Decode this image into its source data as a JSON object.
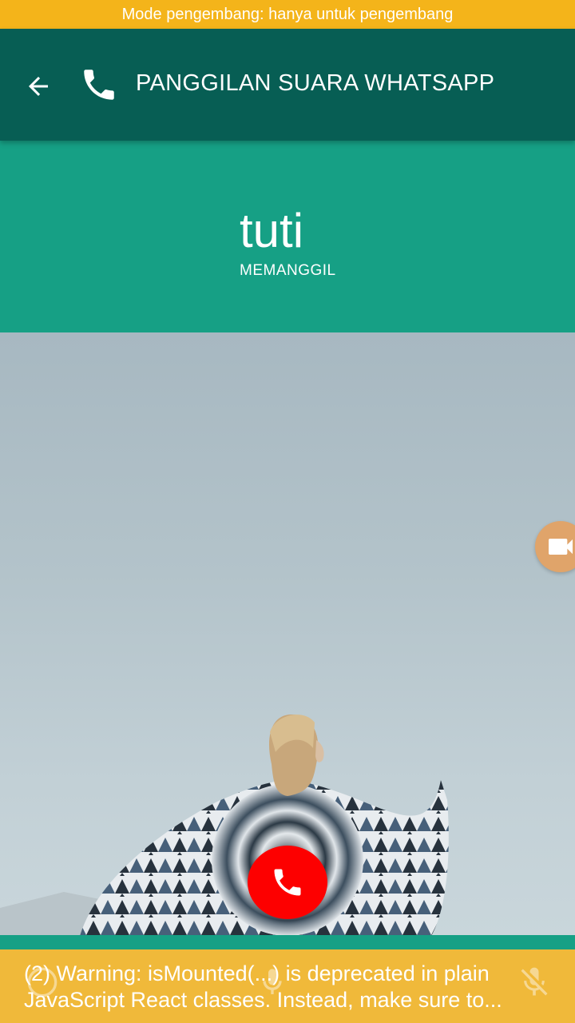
{
  "dev_banner": {
    "text": "Mode pengembang: hanya untuk pengembang"
  },
  "header": {
    "title": "PANGGILAN SUARA WHATSAPP",
    "back_icon": "arrow-left-icon",
    "call_icon": "phone-icon"
  },
  "caller": {
    "name": "tuti",
    "status": "MEMANGGIL"
  },
  "buttons": {
    "video_icon": "video-camera-icon",
    "end_call_icon": "phone-icon"
  },
  "warning": {
    "line1": "(2) Warning: isMounted(...) is deprecated in plain",
    "line2": "JavaScript React classes. Instead, make sure to..."
  },
  "colors": {
    "banner": "#f4b41a",
    "app_bar": "#075e54",
    "panel": "#16a085",
    "end_call": "#fd0000",
    "video_fab": "#e0a46a",
    "warning_bar": "#f0b93a"
  }
}
